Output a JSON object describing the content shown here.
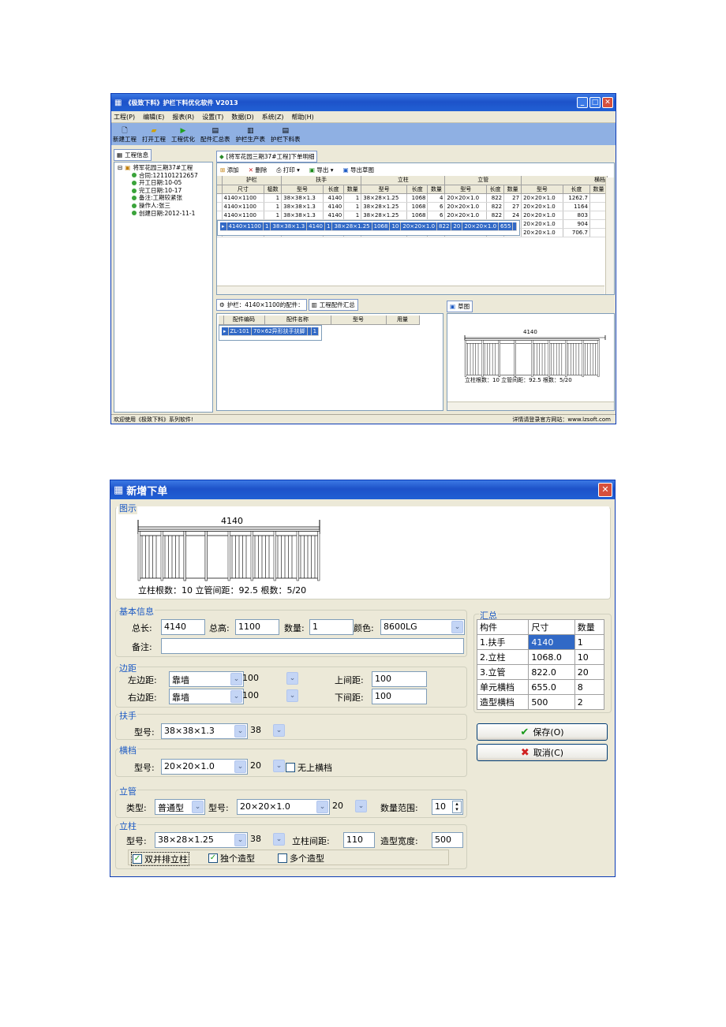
{
  "win1": {
    "title": "《极致下料》护栏下料优化软件 V2013",
    "menu": [
      "工程(P)",
      "编辑(E)",
      "报表(R)",
      "设置(T)",
      "数据(D)",
      "系统(Z)",
      "帮助(H)"
    ],
    "toolbar": [
      "新建工程",
      "打开工程",
      "工程优化",
      "配件汇总表",
      "护栏生产表",
      "护栏下料表"
    ],
    "left_tab": "工程信息",
    "tree_root": "将军花园三期37#工程",
    "tree_items": [
      "合同:121101212657",
      "开工日期:10-05",
      "完工日期:10-17",
      "备注:工期较紧张",
      "操作人:张三",
      "创建日期:2012-11-1"
    ],
    "main_tab": "[将军花园三期37#工程]下单明细",
    "grid_tools": [
      "添加",
      "删除",
      "打印",
      "导出",
      "导出草图"
    ],
    "group_headers": [
      "护栏",
      "扶手",
      "立柱",
      "立管",
      "横档"
    ],
    "columns": [
      "尺寸",
      "榀数",
      "型号",
      "长度",
      "数量",
      "型号",
      "长度",
      "数量",
      "型号",
      "长度",
      "数量",
      "型号",
      "长度",
      "数量"
    ],
    "rows": [
      [
        "4140×1100",
        "1",
        "38×38×1.3",
        "4140",
        "1",
        "38×28×1.25",
        "1068",
        "4",
        "20×20×1.0",
        "822",
        "27",
        "20×20×1.0",
        "1262.7",
        ""
      ],
      [
        "4140×1100",
        "1",
        "38×38×1.3",
        "4140",
        "1",
        "38×28×1.25",
        "1068",
        "6",
        "20×20×1.0",
        "822",
        "27",
        "20×20×1.0",
        "1164",
        ""
      ],
      [
        "4140×1100",
        "1",
        "38×38×1.3",
        "4140",
        "1",
        "38×28×1.25",
        "1068",
        "6",
        "20×20×1.0",
        "822",
        "24",
        "20×20×1.0",
        "803",
        ""
      ],
      [
        "4140×1100",
        "1",
        "38×38×1.3",
        "4140",
        "1",
        "38×28×1.25",
        "1068",
        "10",
        "20×20×1.0",
        "822",
        "20",
        "20×20×1.0",
        "655",
        ""
      ],
      [
        "4140×1100",
        "1",
        "38×38×1.3",
        "4140",
        "1",
        "38×28×1.25",
        "1068",
        "6",
        "20×20×1.0",
        "822",
        "21",
        "20×20×1.0",
        "904",
        ""
      ],
      [
        "4140×1100",
        "1",
        "38×38×1.3",
        "4140",
        "1",
        "38×28×1.25",
        "1068",
        "10",
        "20×20×1.0",
        "822",
        "15",
        "20×20×1.0",
        "706.7",
        ""
      ]
    ],
    "selected_row": 3,
    "sub_tab1": "护栏：4140×1100的配件：",
    "sub_tab2": "工程配件汇总",
    "part_cols": [
      "配件编码",
      "配件名称",
      "型号",
      "用量"
    ],
    "part_row": [
      "ZL-101",
      "70×62异形扶手扶脚",
      "",
      "1"
    ],
    "sketch_tab": "草图",
    "sketch_width": "4140",
    "sketch_caption": "立柱根数：10 立管间距：92.5 根数：5/20",
    "status_left": "欢迎使用《极致下料》系列软件!",
    "status_right": "详情请登录官方网站：www.lzsoft.com"
  },
  "win2": {
    "title": "新增下单",
    "preview_legend": "图示",
    "sketch_width": "4140",
    "sketch_caption": "立柱根数：10 立管间距：92.5 根数：5/20",
    "basic_legend": "基本信息",
    "total_len_label": "总长:",
    "total_len": "4140",
    "total_h_label": "总高:",
    "total_h": "1100",
    "qty_label": "数量:",
    "qty": "1",
    "color_label": "颜色:",
    "color": "8600LG",
    "remark_label": "备注:",
    "margin_legend": "边距",
    "left_margin_label": "左边距:",
    "left_margin_type": "靠墙",
    "left_margin_val": "100",
    "right_margin_label": "右边距:",
    "right_margin_type": "靠墙",
    "right_margin_val": "100",
    "top_gap_label": "上间距:",
    "top_gap": "100",
    "bottom_gap_label": "下间距:",
    "bottom_gap": "100",
    "handrail_legend": "扶手",
    "model_label": "型号:",
    "handrail_model": "38×38×1.3",
    "handrail_size": "38",
    "rail_legend": "横档",
    "rail_model": "20×20×1.0",
    "rail_size": "20",
    "no_top_rail": "无上横档",
    "pipe_legend": "立管",
    "type_label": "类型:",
    "pipe_type": "普通型",
    "pipe_model": "20×20×1.0",
    "pipe_size": "20",
    "range_label": "数量范围:",
    "range_val": "10",
    "post_legend": "立柱",
    "post_model": "38×28×1.25",
    "post_size": "38",
    "post_gap_label": "立柱间距:",
    "post_gap": "110",
    "style_width_label": "造型宽度:",
    "style_width": "500",
    "chk_double": "双并排立柱",
    "chk_single": "独个造型",
    "chk_multi": "多个造型",
    "summary_legend": "汇总",
    "summary_head": [
      "构件",
      "尺寸",
      "数量"
    ],
    "summary_rows": [
      [
        "1.扶手",
        "4140",
        "1"
      ],
      [
        "2.立柱",
        "1068.0",
        "10"
      ],
      [
        "3.立管",
        "822.0",
        "20"
      ],
      [
        "单元横档",
        "655.0",
        "8"
      ],
      [
        "造型横档",
        "500",
        "2"
      ]
    ],
    "save_label": "保存(O)",
    "cancel_label": "取消(C)"
  }
}
